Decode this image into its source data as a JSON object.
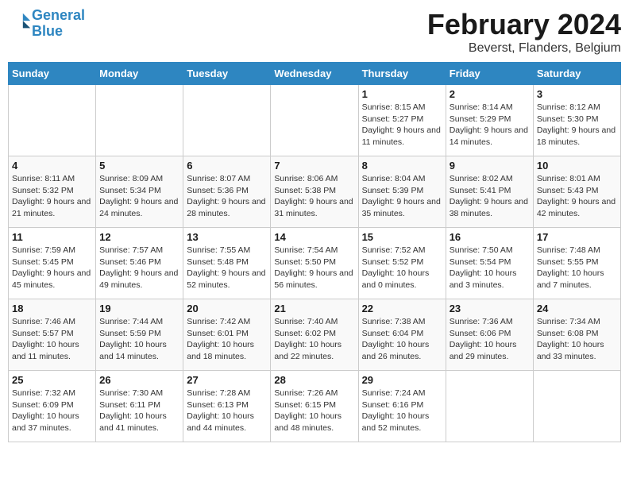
{
  "logo": {
    "text1": "General",
    "text2": "Blue"
  },
  "title": "February 2024",
  "subtitle": "Beverst, Flanders, Belgium",
  "days_of_week": [
    "Sunday",
    "Monday",
    "Tuesday",
    "Wednesday",
    "Thursday",
    "Friday",
    "Saturday"
  ],
  "weeks": [
    [
      {
        "day": "",
        "info": ""
      },
      {
        "day": "",
        "info": ""
      },
      {
        "day": "",
        "info": ""
      },
      {
        "day": "",
        "info": ""
      },
      {
        "day": "1",
        "info": "Sunrise: 8:15 AM\nSunset: 5:27 PM\nDaylight: 9 hours and 11 minutes."
      },
      {
        "day": "2",
        "info": "Sunrise: 8:14 AM\nSunset: 5:29 PM\nDaylight: 9 hours and 14 minutes."
      },
      {
        "day": "3",
        "info": "Sunrise: 8:12 AM\nSunset: 5:30 PM\nDaylight: 9 hours and 18 minutes."
      }
    ],
    [
      {
        "day": "4",
        "info": "Sunrise: 8:11 AM\nSunset: 5:32 PM\nDaylight: 9 hours and 21 minutes."
      },
      {
        "day": "5",
        "info": "Sunrise: 8:09 AM\nSunset: 5:34 PM\nDaylight: 9 hours and 24 minutes."
      },
      {
        "day": "6",
        "info": "Sunrise: 8:07 AM\nSunset: 5:36 PM\nDaylight: 9 hours and 28 minutes."
      },
      {
        "day": "7",
        "info": "Sunrise: 8:06 AM\nSunset: 5:38 PM\nDaylight: 9 hours and 31 minutes."
      },
      {
        "day": "8",
        "info": "Sunrise: 8:04 AM\nSunset: 5:39 PM\nDaylight: 9 hours and 35 minutes."
      },
      {
        "day": "9",
        "info": "Sunrise: 8:02 AM\nSunset: 5:41 PM\nDaylight: 9 hours and 38 minutes."
      },
      {
        "day": "10",
        "info": "Sunrise: 8:01 AM\nSunset: 5:43 PM\nDaylight: 9 hours and 42 minutes."
      }
    ],
    [
      {
        "day": "11",
        "info": "Sunrise: 7:59 AM\nSunset: 5:45 PM\nDaylight: 9 hours and 45 minutes."
      },
      {
        "day": "12",
        "info": "Sunrise: 7:57 AM\nSunset: 5:46 PM\nDaylight: 9 hours and 49 minutes."
      },
      {
        "day": "13",
        "info": "Sunrise: 7:55 AM\nSunset: 5:48 PM\nDaylight: 9 hours and 52 minutes."
      },
      {
        "day": "14",
        "info": "Sunrise: 7:54 AM\nSunset: 5:50 PM\nDaylight: 9 hours and 56 minutes."
      },
      {
        "day": "15",
        "info": "Sunrise: 7:52 AM\nSunset: 5:52 PM\nDaylight: 10 hours and 0 minutes."
      },
      {
        "day": "16",
        "info": "Sunrise: 7:50 AM\nSunset: 5:54 PM\nDaylight: 10 hours and 3 minutes."
      },
      {
        "day": "17",
        "info": "Sunrise: 7:48 AM\nSunset: 5:55 PM\nDaylight: 10 hours and 7 minutes."
      }
    ],
    [
      {
        "day": "18",
        "info": "Sunrise: 7:46 AM\nSunset: 5:57 PM\nDaylight: 10 hours and 11 minutes."
      },
      {
        "day": "19",
        "info": "Sunrise: 7:44 AM\nSunset: 5:59 PM\nDaylight: 10 hours and 14 minutes."
      },
      {
        "day": "20",
        "info": "Sunrise: 7:42 AM\nSunset: 6:01 PM\nDaylight: 10 hours and 18 minutes."
      },
      {
        "day": "21",
        "info": "Sunrise: 7:40 AM\nSunset: 6:02 PM\nDaylight: 10 hours and 22 minutes."
      },
      {
        "day": "22",
        "info": "Sunrise: 7:38 AM\nSunset: 6:04 PM\nDaylight: 10 hours and 26 minutes."
      },
      {
        "day": "23",
        "info": "Sunrise: 7:36 AM\nSunset: 6:06 PM\nDaylight: 10 hours and 29 minutes."
      },
      {
        "day": "24",
        "info": "Sunrise: 7:34 AM\nSunset: 6:08 PM\nDaylight: 10 hours and 33 minutes."
      }
    ],
    [
      {
        "day": "25",
        "info": "Sunrise: 7:32 AM\nSunset: 6:09 PM\nDaylight: 10 hours and 37 minutes."
      },
      {
        "day": "26",
        "info": "Sunrise: 7:30 AM\nSunset: 6:11 PM\nDaylight: 10 hours and 41 minutes."
      },
      {
        "day": "27",
        "info": "Sunrise: 7:28 AM\nSunset: 6:13 PM\nDaylight: 10 hours and 44 minutes."
      },
      {
        "day": "28",
        "info": "Sunrise: 7:26 AM\nSunset: 6:15 PM\nDaylight: 10 hours and 48 minutes."
      },
      {
        "day": "29",
        "info": "Sunrise: 7:24 AM\nSunset: 6:16 PM\nDaylight: 10 hours and 52 minutes."
      },
      {
        "day": "",
        "info": ""
      },
      {
        "day": "",
        "info": ""
      }
    ]
  ]
}
